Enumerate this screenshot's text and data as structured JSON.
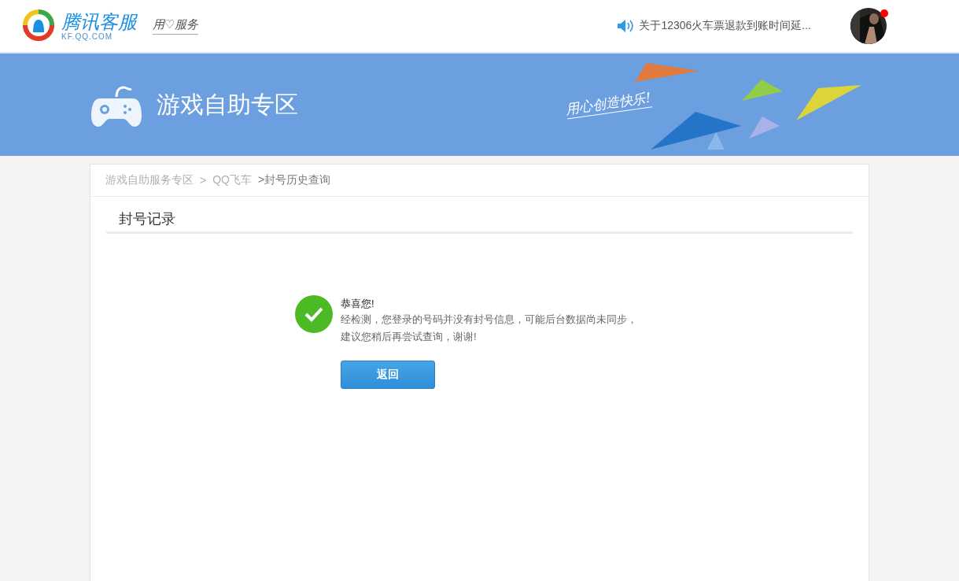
{
  "header": {
    "logo": {
      "title": "腾讯客服",
      "domain": "KF.QQ.COM",
      "slogan": "用♡服务"
    },
    "notice": "关于12306火车票退款到账时间延...",
    "avatar": {
      "unread": true
    }
  },
  "banner": {
    "title": "游戏自助专区",
    "slogan": "用心创造快乐!"
  },
  "breadcrumb": [
    {
      "label": "游戏自助服务专区",
      "kind": "link"
    },
    {
      "label": ">",
      "kind": "separator"
    },
    {
      "label": "QQ飞车",
      "kind": "link"
    },
    {
      "label": ">封号历史查询",
      "kind": "current"
    }
  ],
  "section_title": "封号记录",
  "result": {
    "success": true,
    "heading": "恭喜您!",
    "lines": [
      "经检测，您登录的号码并没有封号信息，可能后台数据尚未同步，",
      "建议您稍后再尝试查询，谢谢!"
    ],
    "button": "返回"
  }
}
